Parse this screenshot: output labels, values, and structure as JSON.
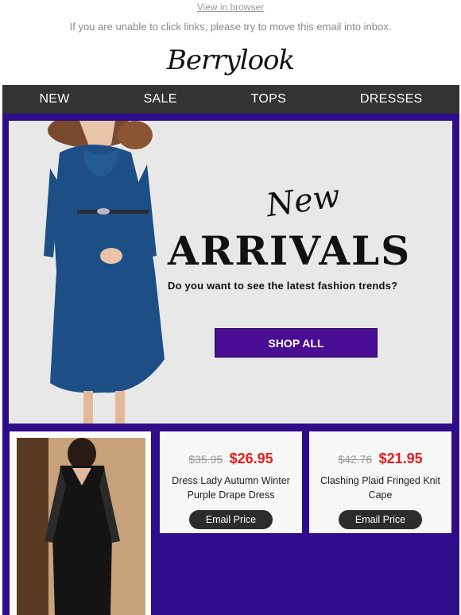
{
  "header": {
    "view_in_browser": "View in browser",
    "notice": "If you are unable to click links, please try to move this email into inbox.",
    "logo_text": "Berrylook"
  },
  "nav": {
    "items": [
      "NEW",
      "SALE",
      "TOPS",
      "DRESSES"
    ]
  },
  "banner": {
    "script_text": "New",
    "headline": "ARRIVALS",
    "subtitle": "Do you want to see the latest fashion trends?",
    "cta_label": "SHOP ALL"
  },
  "products": [
    {
      "old_price": "$35.95",
      "new_price": "$26.95",
      "name": "Dress Lady Autumn Winter Purple Drape Dress",
      "button_label": "Email Price"
    },
    {
      "old_price": "$42.76",
      "new_price": "$21.95",
      "name": "Clashing Plaid Fringed Knit Cape",
      "button_label": "Email Price"
    }
  ],
  "colors": {
    "nav_bg": "#333333",
    "brand_purple": "#2f0c8a",
    "cta_purple": "#4a0c92",
    "sale_red": "#e81919"
  }
}
